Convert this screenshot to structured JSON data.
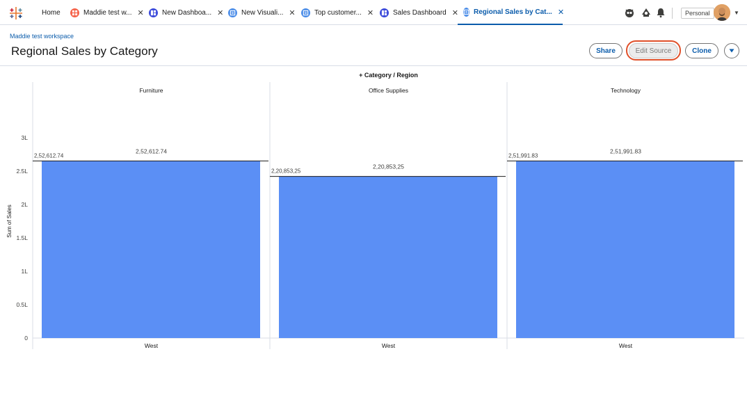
{
  "tabs": [
    {
      "label": "Home",
      "icon": "none",
      "closable": false,
      "active": false
    },
    {
      "label": "Maddie test w...",
      "icon": "workspace-icon",
      "color": "#f5634a",
      "closable": true,
      "active": false
    },
    {
      "label": "New Dashboa...",
      "icon": "dashboard-icon",
      "color": "#3a49da",
      "closable": true,
      "active": false
    },
    {
      "label": "New Visuali...",
      "icon": "visualization-icon",
      "color": "#4a8ce8",
      "closable": true,
      "active": false
    },
    {
      "label": "Top customer...",
      "icon": "visualization-icon",
      "color": "#4a8ce8",
      "closable": true,
      "active": false
    },
    {
      "label": "Sales Dashboard",
      "icon": "dashboard-icon",
      "color": "#3a49da",
      "closable": true,
      "active": false
    },
    {
      "label": "Regional Sales by Cat...",
      "icon": "visualization-icon",
      "color": "#4a8ce8",
      "closable": true,
      "active": true
    }
  ],
  "toolbar": {
    "personal_label": "Personal",
    "icons": [
      "einstein-icon",
      "agentforce-icon",
      "bell-icon"
    ]
  },
  "header": {
    "breadcrumb": "Maddie test workspace",
    "title": "Regional Sales by Category",
    "share_label": "Share",
    "edit_source_label": "Edit Source",
    "clone_label": "Clone"
  },
  "colors": {
    "accent": "#0b5cab",
    "bar": "#5b8ff5",
    "highlight": "#e0502a"
  },
  "chart_data": {
    "type": "bar",
    "title": "+ Category / Region",
    "ylabel": "Sum of Sales",
    "ylim": [
      0,
      3500000
    ],
    "yticks": [
      {
        "value": 0,
        "label": "0"
      },
      {
        "value": 500000,
        "label": "0.5L"
      },
      {
        "value": 1000000,
        "label": "1L"
      },
      {
        "value": 1500000,
        "label": "1.5L"
      },
      {
        "value": 2000000,
        "label": "2L"
      },
      {
        "value": 2500000,
        "label": "2.5L"
      },
      {
        "value": 3000000,
        "label": "3L"
      }
    ],
    "panels": [
      {
        "category": "Furniture",
        "region": "West",
        "value": 2652612.74,
        "label": "2,52,612.74",
        "ref_label": "2,52,612.74"
      },
      {
        "category": "Office Supplies",
        "region": "West",
        "value": 2420853.25,
        "label": "2,20,853,25",
        "ref_label": "2,20,853,25"
      },
      {
        "category": "Technology",
        "region": "West",
        "value": 2651991.83,
        "label": "2,51,991.83",
        "ref_label": "2,51,991.83"
      }
    ]
  }
}
